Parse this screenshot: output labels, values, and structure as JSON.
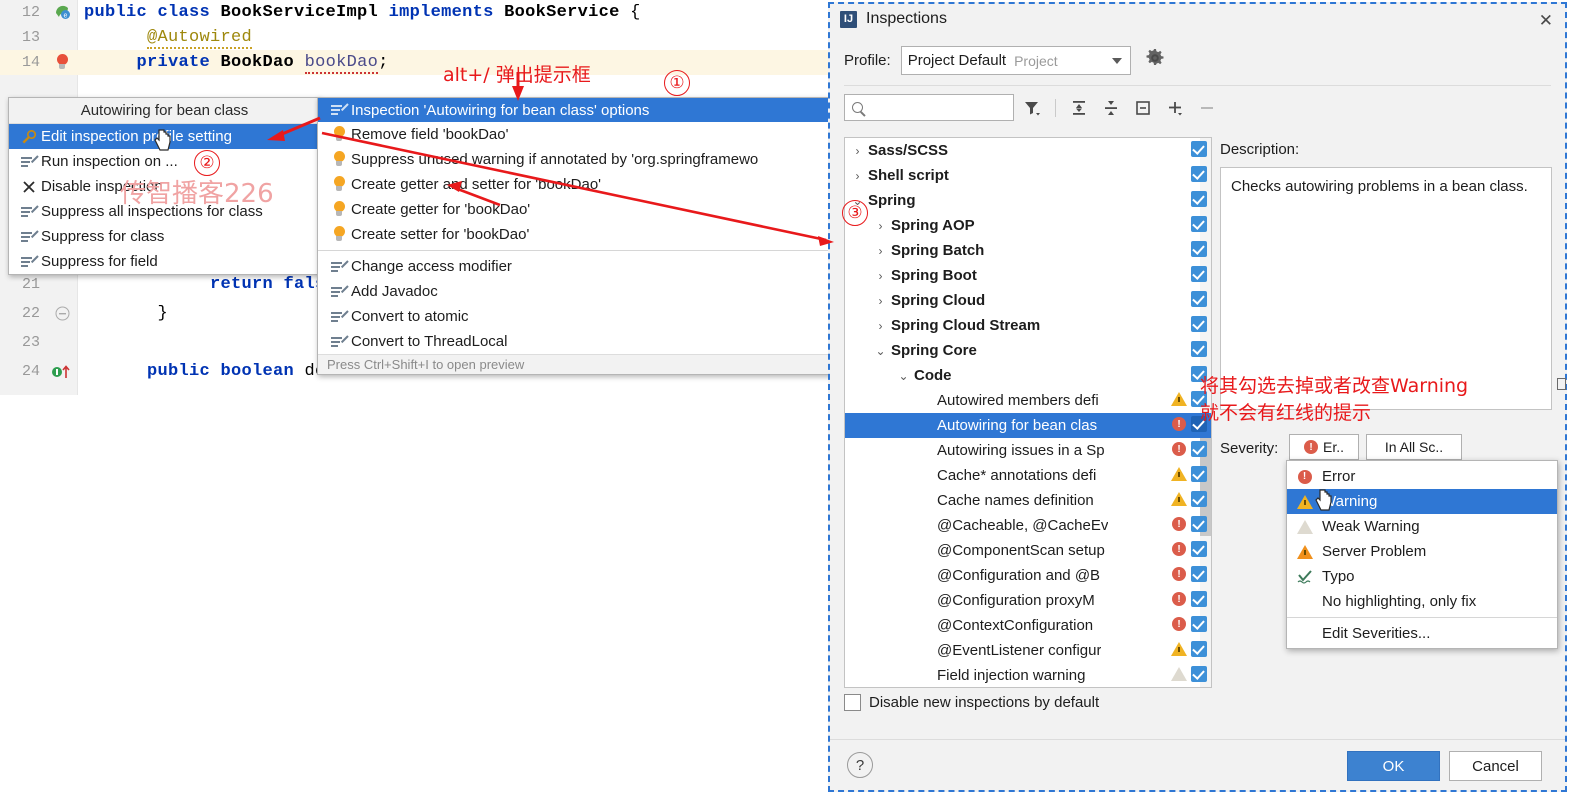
{
  "editor": {
    "lines": [
      {
        "num": "12",
        "gutter": "spring-bean-icon",
        "text": "public class BookServiceImpl implements BookService {"
      },
      {
        "num": "13",
        "gutter": "",
        "text": "@Autowired"
      },
      {
        "num": "14",
        "gutter": "red-bulb-icon",
        "text": "private BookDao bookDao;"
      },
      {
        "num": "21",
        "gutter": "",
        "text": "return false;"
      },
      {
        "num": "22",
        "gutter": "fold-icon",
        "text": "}"
      },
      {
        "num": "23",
        "gutter": "",
        "text": ""
      },
      {
        "num": "24",
        "gutter": "override-icon",
        "text": "public boolean de"
      }
    ]
  },
  "menu1": {
    "title": "Autowiring for bean class",
    "items": [
      {
        "label": "Edit inspection profile setting",
        "icon": "wrench-icon",
        "selected": true
      },
      {
        "label": "Run inspection on ...",
        "icon": "pencil-icon",
        "selected": false
      },
      {
        "label": "Disable inspection",
        "icon": "close-icon",
        "selected": false
      },
      {
        "label": "Suppress all inspections for class",
        "icon": "pencil-icon",
        "selected": false
      },
      {
        "label": "Suppress for class",
        "icon": "pencil-icon",
        "selected": false
      },
      {
        "label": "Suppress for field",
        "icon": "pencil-icon",
        "selected": false
      }
    ]
  },
  "menu2": {
    "header": "Inspection 'Autowiring for bean class' options",
    "group1": [
      {
        "label": "Remove field 'bookDao'",
        "icon": "bulb-icon"
      },
      {
        "label": "Suppress unused warning if annotated by 'org.springframewo",
        "icon": "bulb-icon"
      },
      {
        "label": "Create getter and setter for 'bookDao'",
        "icon": "bulb-icon"
      },
      {
        "label": "Create getter for 'bookDao'",
        "icon": "bulb-icon"
      },
      {
        "label": "Create setter for 'bookDao'",
        "icon": "bulb-icon"
      }
    ],
    "group2": [
      {
        "label": "Change access modifier",
        "icon": "pencil-icon"
      },
      {
        "label": "Add Javadoc",
        "icon": "pencil-icon"
      },
      {
        "label": "Convert to atomic",
        "icon": "pencil-icon"
      },
      {
        "label": "Convert to ThreadLocal",
        "icon": "pencil-icon"
      }
    ],
    "footer": "Press Ctrl+Shift+I to open preview"
  },
  "dialog": {
    "title": "Inspections",
    "close": "✕",
    "profile_label": "Profile:",
    "profile_value": "Project Default",
    "profile_scope": "Project",
    "search_placeholder": "",
    "toolbar": [
      {
        "name": "filter-icon"
      },
      {
        "name": "expand-all-icon"
      },
      {
        "name": "collapse-all-icon"
      },
      {
        "name": "show-only-enabled-icon"
      },
      {
        "name": "add-icon"
      },
      {
        "name": "remove-icon"
      }
    ],
    "tree": [
      {
        "label": "Sass/SCSS",
        "indent": 0,
        "arrow": "›",
        "bold": true,
        "checked": true,
        "severity": "",
        "selected": false
      },
      {
        "label": "Shell script",
        "indent": 0,
        "arrow": "›",
        "bold": true,
        "checked": true,
        "severity": "",
        "selected": false
      },
      {
        "label": "Spring",
        "indent": 0,
        "arrow": "⌄",
        "bold": true,
        "checked": true,
        "severity": "",
        "selected": false
      },
      {
        "label": "Spring AOP",
        "indent": 1,
        "arrow": "›",
        "bold": true,
        "checked": true,
        "severity": "",
        "selected": false
      },
      {
        "label": "Spring Batch",
        "indent": 1,
        "arrow": "›",
        "bold": true,
        "checked": true,
        "severity": "",
        "selected": false
      },
      {
        "label": "Spring Boot",
        "indent": 1,
        "arrow": "›",
        "bold": true,
        "checked": true,
        "severity": "",
        "selected": false
      },
      {
        "label": "Spring Cloud",
        "indent": 1,
        "arrow": "›",
        "bold": true,
        "checked": true,
        "severity": "",
        "selected": false
      },
      {
        "label": "Spring Cloud Stream",
        "indent": 1,
        "arrow": "›",
        "bold": true,
        "checked": true,
        "severity": "",
        "selected": false
      },
      {
        "label": "Spring Core",
        "indent": 1,
        "arrow": "⌄",
        "bold": true,
        "checked": true,
        "severity": "",
        "selected": false
      },
      {
        "label": "Code",
        "indent": 2,
        "arrow": "⌄",
        "bold": true,
        "checked": true,
        "severity": "",
        "selected": false
      },
      {
        "label": "Autowired members defi",
        "indent": 3,
        "arrow": "",
        "bold": false,
        "checked": true,
        "severity": "warning",
        "selected": false
      },
      {
        "label": "Autowiring for bean clas",
        "indent": 3,
        "arrow": "",
        "bold": false,
        "checked": true,
        "severity": "error",
        "selected": true
      },
      {
        "label": "Autowiring issues in a Sp",
        "indent": 3,
        "arrow": "",
        "bold": false,
        "checked": true,
        "severity": "error",
        "selected": false
      },
      {
        "label": "Cache* annotations defi",
        "indent": 3,
        "arrow": "",
        "bold": false,
        "checked": true,
        "severity": "warning",
        "selected": false
      },
      {
        "label": "Cache names definition ",
        "indent": 3,
        "arrow": "",
        "bold": false,
        "checked": true,
        "severity": "warning",
        "selected": false
      },
      {
        "label": "@Cacheable, @CacheEv",
        "indent": 3,
        "arrow": "",
        "bold": false,
        "checked": true,
        "severity": "error",
        "selected": false
      },
      {
        "label": "@ComponentScan setup",
        "indent": 3,
        "arrow": "",
        "bold": false,
        "checked": true,
        "severity": "error",
        "selected": false
      },
      {
        "label": "@Configuration and @B",
        "indent": 3,
        "arrow": "",
        "bold": false,
        "checked": true,
        "severity": "error",
        "selected": false
      },
      {
        "label": "@Configuration proxyM",
        "indent": 3,
        "arrow": "",
        "bold": false,
        "checked": true,
        "severity": "error",
        "selected": false
      },
      {
        "label": "@ContextConfiguration",
        "indent": 3,
        "arrow": "",
        "bold": false,
        "checked": true,
        "severity": "error",
        "selected": false
      },
      {
        "label": "@EventListener configur",
        "indent": 3,
        "arrow": "",
        "bold": false,
        "checked": true,
        "severity": "warning",
        "selected": false
      },
      {
        "label": "Field injection warning",
        "indent": 3,
        "arrow": "",
        "bold": false,
        "checked": true,
        "severity": "weak",
        "selected": false
      }
    ],
    "disable_new_label": "Disable new inspections by default",
    "disable_new_checked": false,
    "description_label": "Description:",
    "description_text": "Checks autowiring problems in a bean class.",
    "severity_label": "Severity:",
    "severity_value": "Er..",
    "scope_value": "In All Sc..",
    "severity_options": [
      {
        "label": "Error",
        "icon": "error-icon",
        "selected": false
      },
      {
        "label": "Warning",
        "icon": "warning-icon",
        "selected": true
      },
      {
        "label": "Weak Warning",
        "icon": "weak-warning-icon",
        "selected": false
      },
      {
        "label": "Server Problem",
        "icon": "server-problem-icon",
        "selected": false
      },
      {
        "label": "Typo",
        "icon": "typo-icon",
        "selected": false
      },
      {
        "label": "No highlighting, only fix",
        "icon": "",
        "selected": false
      }
    ],
    "severity_edit": "Edit Severities...",
    "help_label": "?",
    "ok_label": "OK",
    "cancel_label": "Cancel"
  },
  "annotations": {
    "alt_slash": "alt+/ 弹出提示框",
    "circle1": "①",
    "circle2": "②",
    "circle3": "③",
    "watermark": "传智播客226",
    "right_note_line1": "将其勾选去掉或者改查Warning",
    "right_note_line2": "就不会有红线的提示"
  },
  "colors": {
    "accent": "#2f77d4",
    "annotation_red": "#e8191b",
    "checkbox_blue": "#3d90d8",
    "ok_button": "#3d82d0"
  }
}
